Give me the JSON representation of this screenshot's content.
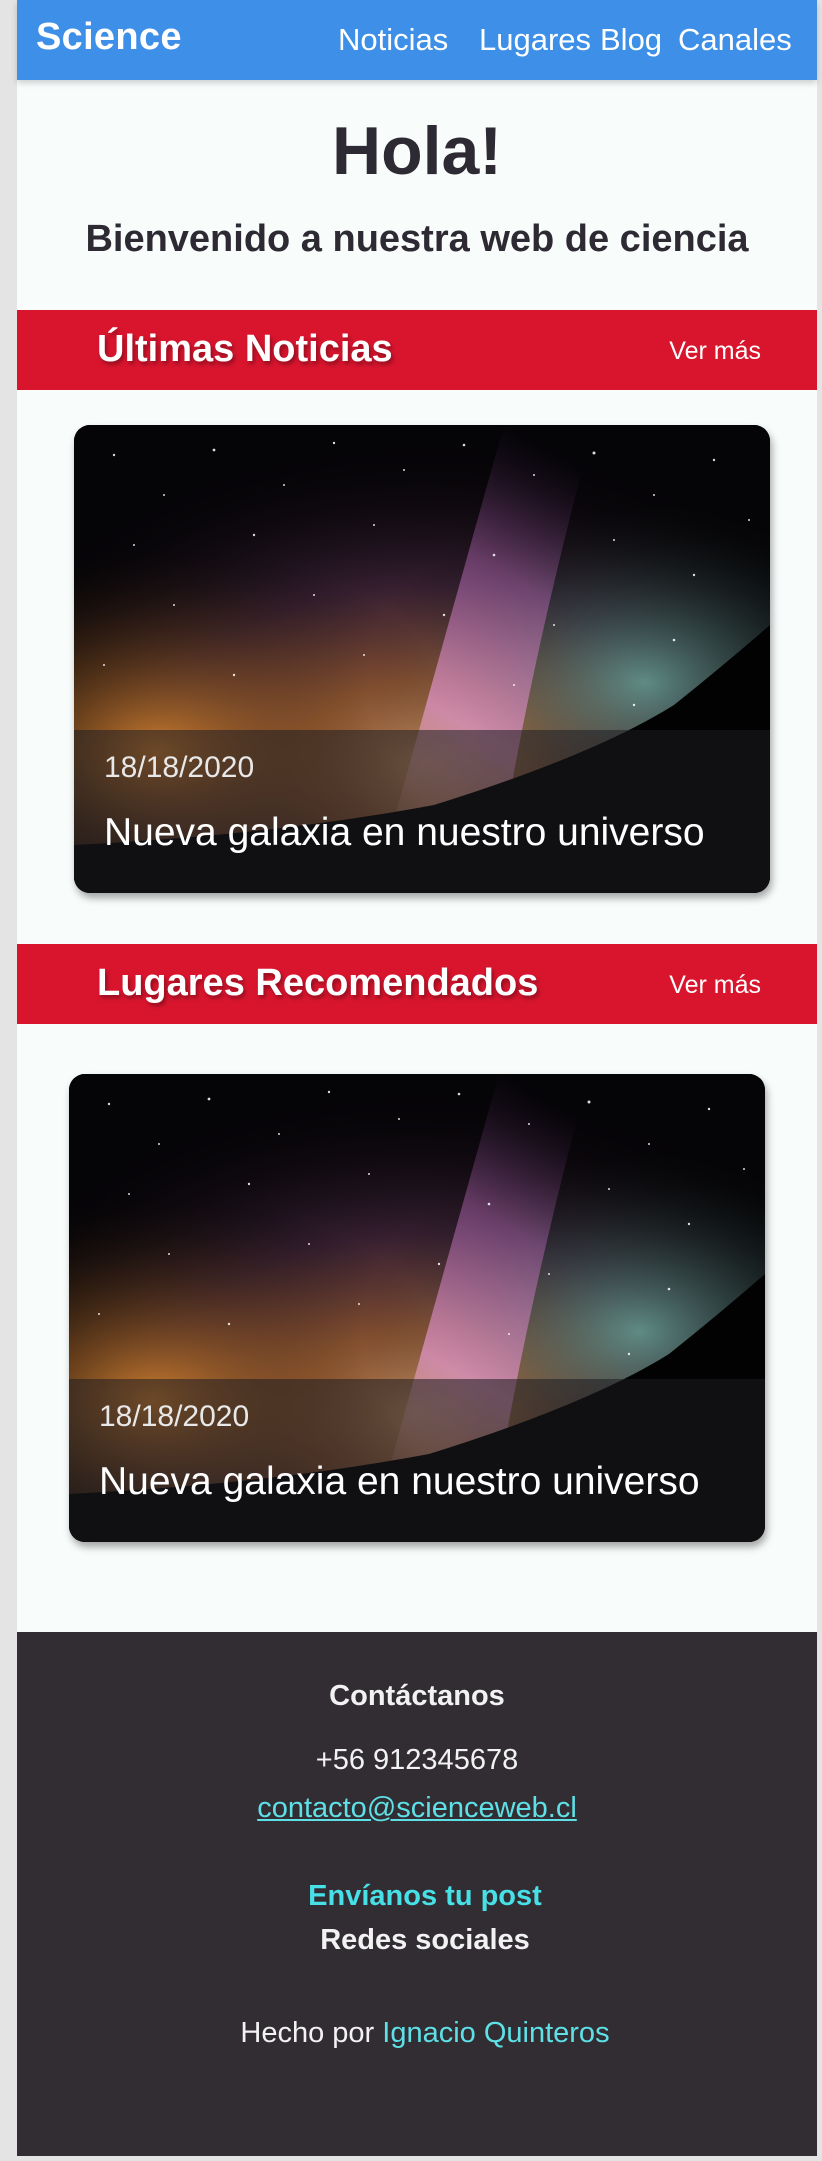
{
  "nav": {
    "brand": "Science",
    "links": [
      "Noticias",
      "Lugares",
      "Blog",
      "Canales"
    ]
  },
  "hero": {
    "title": "Hola!",
    "subtitle": "Bienvenido a nuestra web de ciencia"
  },
  "sections": [
    {
      "title": "Últimas Noticias",
      "more_label": "Ver más",
      "card": {
        "date": "18/18/2020",
        "title": "Nueva galaxia en nuestro universo"
      }
    },
    {
      "title": "Lugares Recomendados",
      "more_label": "Ver más",
      "card": {
        "date": "18/18/2020",
        "title": "Nueva galaxia en nuestro universo"
      }
    }
  ],
  "footer": {
    "heading": "Contáctanos",
    "phone": "+56 912345678",
    "email": "contacto@scienceweb.cl",
    "post_link": "Envíanos tu post",
    "social": "Redes sociales",
    "credit_prefix": "Hecho por ",
    "author": "Ignacio Quinteros"
  },
  "colors": {
    "nav_bg": "#3d8fe8",
    "section_bar": "#d9152e",
    "footer_bg": "#312d33",
    "link_cyan": "#5ee0e6",
    "page_bg": "#f8fcfb"
  }
}
